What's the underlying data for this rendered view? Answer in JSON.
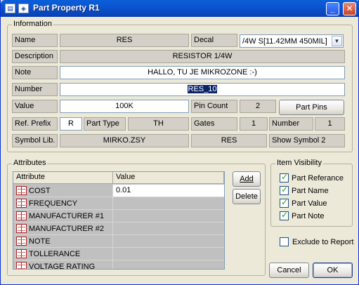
{
  "window": {
    "title": "Part Property R1",
    "minimize": "_",
    "close": "✕"
  },
  "information": {
    "legend": "Information",
    "name_label": "Name",
    "name_value": "RES",
    "decal_label": "Decal",
    "decal_value": "/4W S[11.42MM 450MIL]",
    "description_label": "Description",
    "description_value": "RESISTOR 1/4W",
    "note_label": "Note",
    "note_value": "HALLO, TU JE MIKROZONE :-)",
    "number_label": "Number",
    "number_value": "RES_10",
    "value_label": "Value",
    "value_value": "100K",
    "pin_count_label": "Pin Count",
    "pin_count_value": "2",
    "part_pins_button": "Part Pins",
    "ref_prefix_label": "Ref. Prefix",
    "ref_prefix_value": "R",
    "part_type_label": "Part Type",
    "part_type_value": "TH",
    "gates_label": "Gates",
    "gates_value": "1",
    "number2_label": "Number",
    "number2_value": "1",
    "symbol_lib_label": "Symbol Lib.",
    "symbol_lib_value": "MIRKO.ZSY",
    "symbol_name": "RES",
    "show_symbol": "Show Symbol 2"
  },
  "attributes": {
    "legend": "Attributes",
    "col_attribute": "Attribute",
    "col_value": "Value",
    "add_button": "Add",
    "delete_button": "Delete",
    "rows": [
      {
        "name": "COST",
        "value": "0.01"
      },
      {
        "name": "FREQUENCY",
        "value": ""
      },
      {
        "name": "MANUFACTURER #1",
        "value": ""
      },
      {
        "name": "MANUFACTURER #2",
        "value": ""
      },
      {
        "name": "NOTE",
        "value": ""
      },
      {
        "name": "TOLLERANCE",
        "value": ""
      },
      {
        "name": "VOLTAGE RATING",
        "value": ""
      }
    ]
  },
  "visibility": {
    "legend": "Item Visibility",
    "part_referance": "Part Referance",
    "part_name": "Part Name",
    "part_value": "Part Value",
    "part_note": "Part Note"
  },
  "exclude_to_report": "Exclude to Report",
  "cancel_button": "Cancel",
  "ok_button": "OK"
}
